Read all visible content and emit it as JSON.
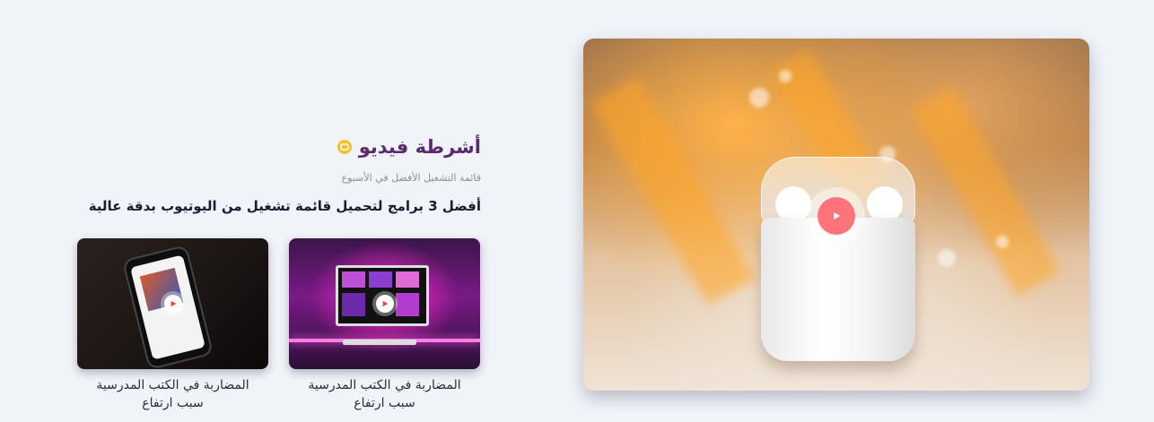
{
  "section": {
    "title": "أشرطة فيديو",
    "subtitle": "قائمة التشغيل الأفضل في الأسبوع",
    "headline": "أفضل 3 برامج لتحميل قائمة تشغيل من اليوتيوب بدقة عالية"
  },
  "featured_video": {
    "icon": "play-icon",
    "play_color": "#ff7479"
  },
  "cards": [
    {
      "caption_line1": "المضاربة في الكتب المدرسية",
      "caption_line2": "سبب ارتفاع",
      "icon": "play-icon"
    },
    {
      "caption_line1": "المضاربة في الكتب المدرسية",
      "caption_line2": "سبب ارتفاع",
      "icon": "play-icon"
    }
  ],
  "colors": {
    "title": "#5a2b6f",
    "title_icon": "#f2c12e",
    "headline": "#1c1b33",
    "play_accent": "#ff3b3b",
    "background": "#f0f4f9"
  }
}
